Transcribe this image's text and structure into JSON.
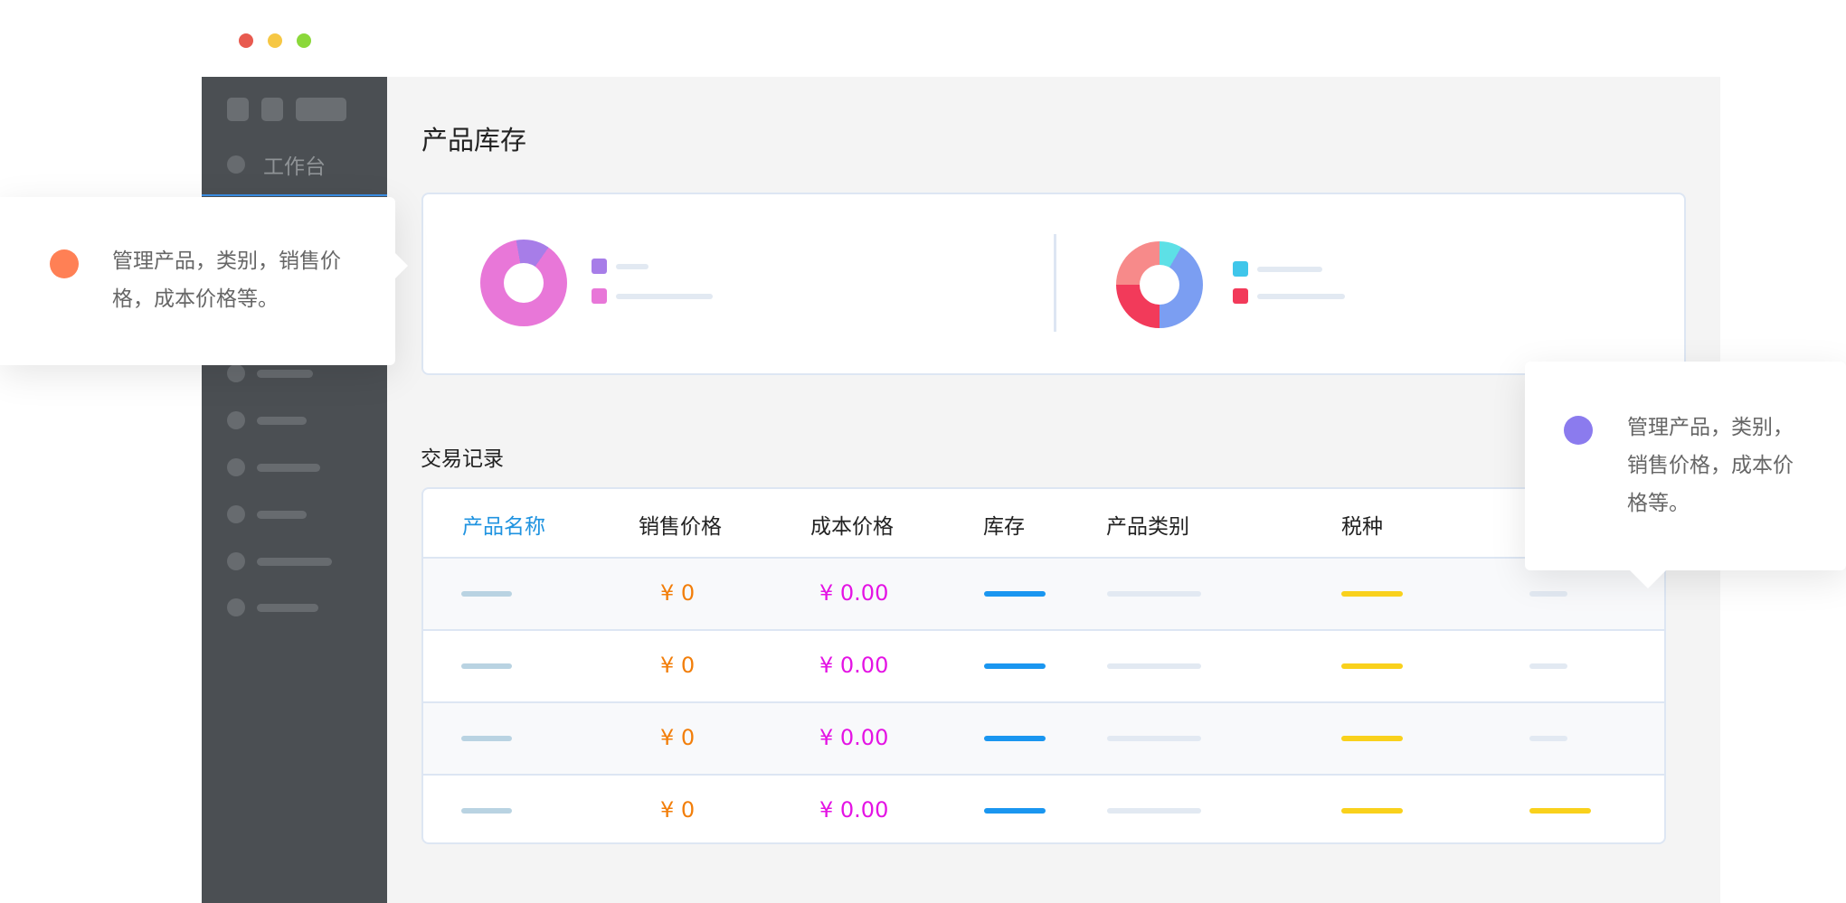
{
  "window_controls": {
    "close_color": "#e85a4f",
    "minimize_color": "#f6c744",
    "maximize_color": "#8bd83a"
  },
  "sidebar": {
    "workbench_label": "工作台"
  },
  "page_title": "产品库存",
  "chart_card": {
    "donut_1_colors": [
      "#a77de8",
      "#e877d8"
    ],
    "donut_2_colors": [
      "#5de0e6",
      "#7b9ef2",
      "#f23a5a",
      "#f78a8a"
    ]
  },
  "section_title": "交易记录",
  "table": {
    "headers": [
      "产品名称",
      "销售价格",
      "成本价格",
      "库存",
      "产品类别",
      "税种"
    ],
    "rows": [
      {
        "price": "¥ 0",
        "cost": "¥ 0.00"
      },
      {
        "price": "¥ 0",
        "cost": "¥ 0.00"
      },
      {
        "price": "¥ 0",
        "cost": "¥ 0.00"
      },
      {
        "price": "¥ 0",
        "cost": "¥ 0.00"
      }
    ]
  },
  "callouts": {
    "left": {
      "line1": "管理产品，类别，销售价",
      "line2": "格，成本价格等。",
      "dot_color": "#ff8055"
    },
    "right": {
      "line1": "管理产品，类别，",
      "line2": "销售价格，成本价",
      "line3": "格等。",
      "dot_color": "#8b7bee"
    }
  },
  "colors": {
    "accent_blue": "#1f93e0",
    "price_orange": "#f27e0a",
    "cost_magenta": "#e413e4",
    "stock_bar": "#1a96f0",
    "tax_bar": "#f9d11c"
  }
}
